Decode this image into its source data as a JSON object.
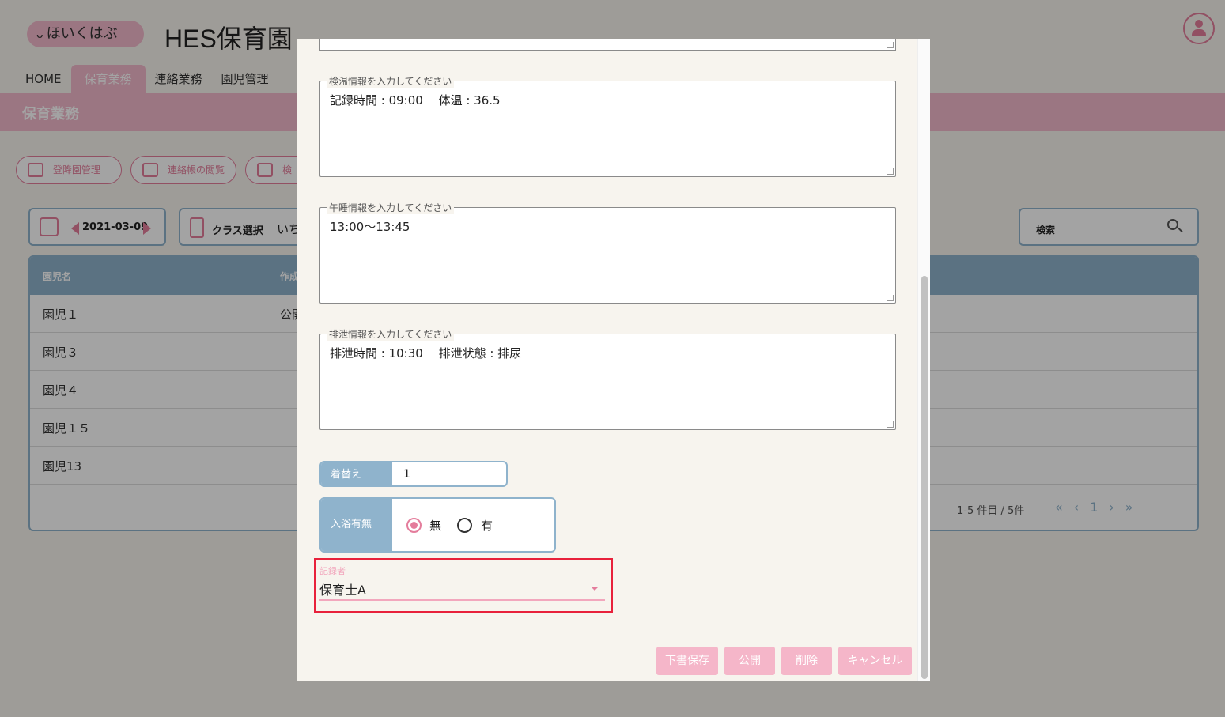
{
  "app": {
    "logo_text": "ほいくはぶ",
    "title": "HES保育園"
  },
  "nav": {
    "tabs": [
      "HOME",
      "保育業務",
      "連絡業務",
      "園児管理"
    ],
    "active": "保育業務"
  },
  "page_title": "保育業務",
  "action_pills": [
    "登降園管理",
    "連絡帳の閲覧",
    "検"
  ],
  "toolbar": {
    "date": "2021-03-09",
    "class_label": "クラス選択",
    "class_value": "いち",
    "search_label": "検索"
  },
  "table": {
    "headers": [
      "園児名",
      "作成"
    ],
    "rows": [
      {
        "name": "園児１",
        "status": "公開"
      },
      {
        "name": "園児３",
        "status": ""
      },
      {
        "name": "園児４",
        "status": ""
      },
      {
        "name": "園児１５",
        "status": ""
      },
      {
        "name": "園児13",
        "status": ""
      }
    ],
    "pagination_summary": "1-5 件目 / 5件",
    "current_page": "1"
  },
  "dialog": {
    "fields": [
      {
        "legend": "検温情報を入力してください",
        "value": "記録時間 : 09:00　 体温 : 36.5"
      },
      {
        "legend": "午睡情報を入力してください",
        "value": "13:00〜13:45"
      },
      {
        "legend": "排泄情報を入力してください",
        "value": "排泄時間 : 10:30　 排泄状態 : 排尿"
      }
    ],
    "change_clothes": {
      "label": "着替え",
      "value": "1"
    },
    "bath": {
      "label": "入浴有無",
      "options": [
        "無",
        "有"
      ],
      "selected": "無"
    },
    "recorder": {
      "label": "記録者",
      "value": "保育士A"
    },
    "buttons": {
      "draft": "下書保存",
      "publish": "公開",
      "delete": "削除",
      "cancel": "キャンセル"
    }
  },
  "colors": {
    "accent_pink": "#f3b9cc",
    "accent_blue": "#8fb3cc",
    "highlight_red": "#e8213b"
  }
}
